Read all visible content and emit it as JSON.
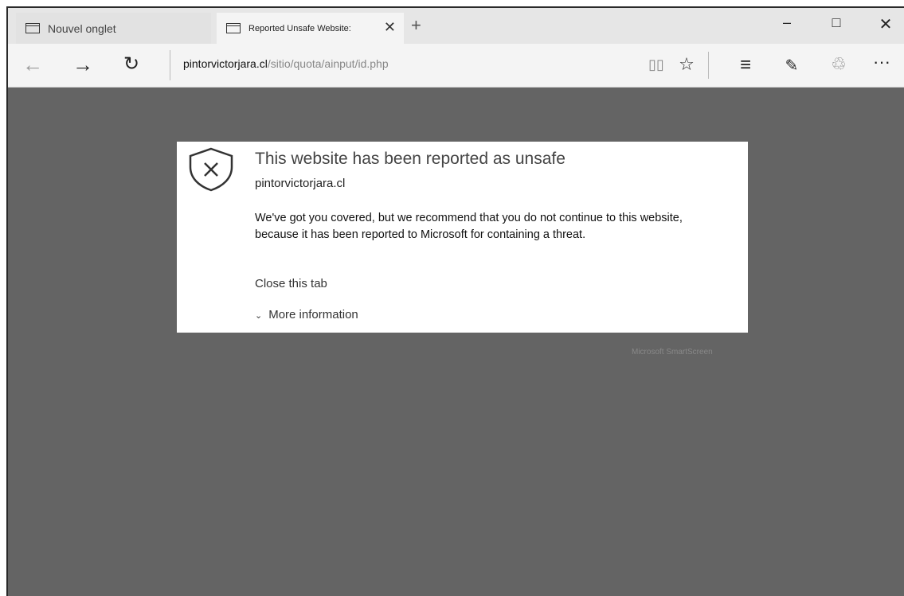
{
  "tabs": [
    {
      "title": "Nouvel onglet"
    },
    {
      "title": "Reported Unsafe Website:",
      "close": "✕"
    }
  ],
  "new_tab": "+",
  "window_controls": {
    "minimize": "–",
    "maximize": "□",
    "close": "✕"
  },
  "nav": {
    "back": "←",
    "forward": "→",
    "refresh": "↻",
    "address_host": "pintorvictorjara.cl",
    "address_path": "/sitio/quota/ainput/id.php",
    "icons": {
      "reading": "book-icon",
      "favorite": "star-icon",
      "hub": "hub-icon",
      "note": "web-note-icon",
      "share": "share-icon",
      "more": "more-icon"
    },
    "favorite_glyph": "☆",
    "hub_glyph": "≡",
    "note_glyph": "✎",
    "share_glyph": "♲",
    "more_glyph": "···",
    "reading_glyph": "▯▯"
  },
  "warning": {
    "title": "This website has been reported as unsafe",
    "host": "pintorvictorjara.cl",
    "body": "We've got you covered, but we recommend that you do not continue to this website, because it has been reported to Microsoft for containing a threat.",
    "close_link": "Close this tab",
    "more_chevron": "⌄",
    "more_link": "More information",
    "footer": "Microsoft SmartScreen"
  },
  "colors": {
    "content_bg": "#646464",
    "dialog_bg": "#ffffff",
    "tab_active": "#f4f4f4"
  }
}
